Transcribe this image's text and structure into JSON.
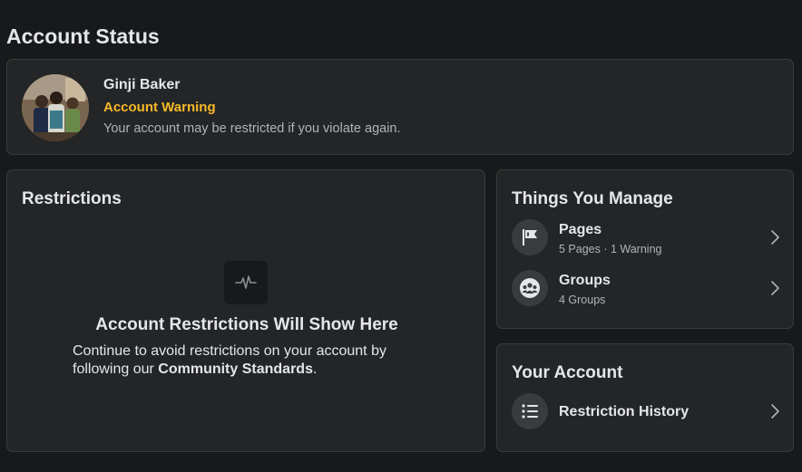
{
  "page": {
    "title": "Account Status"
  },
  "status": {
    "name": "Ginji Baker",
    "warning_label": "Account Warning",
    "warning_description": "Your account may be restricted if you violate again.",
    "warning_color": "#f7b928"
  },
  "restrictions": {
    "title": "Restrictions",
    "icon": "activity-pulse-icon",
    "empty_title": "Account Restrictions Will Show Here",
    "empty_desc_prefix": "Continue to avoid restrictions on your account by following our ",
    "empty_desc_link": "Community Standards",
    "empty_desc_suffix": "."
  },
  "manage": {
    "title": "Things You Manage",
    "items": [
      {
        "label": "Pages",
        "subtitle": "5 Pages · 1 Warning",
        "icon": "flag-icon"
      },
      {
        "label": "Groups",
        "subtitle": "4 Groups",
        "icon": "groups-icon"
      }
    ]
  },
  "account": {
    "title": "Your Account",
    "items": [
      {
        "label": "Restriction History",
        "icon": "list-icon"
      }
    ]
  }
}
